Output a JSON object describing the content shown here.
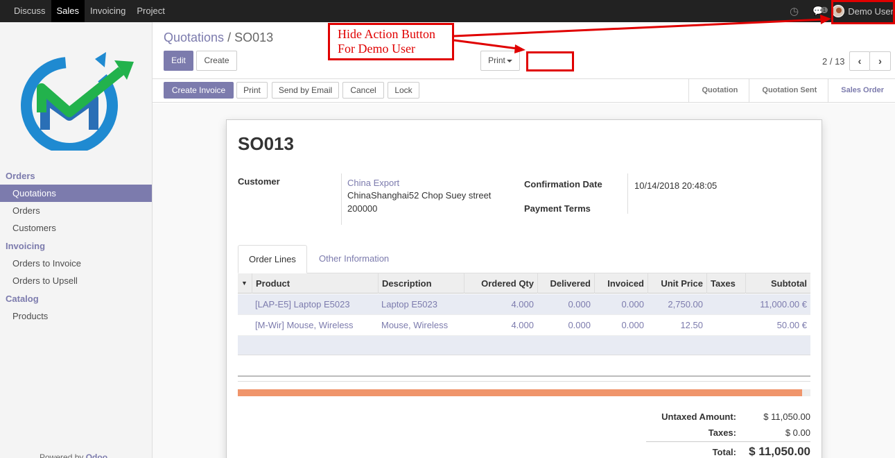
{
  "topbar": {
    "menu": [
      "Discuss",
      "Sales",
      "Invoicing",
      "Project"
    ],
    "active_menu": "Sales",
    "chat_count": "1",
    "user": "Demo User"
  },
  "sidebar": {
    "categories": [
      {
        "label": "Orders",
        "items": [
          "Quotations",
          "Orders",
          "Customers"
        ]
      },
      {
        "label": "Invoicing",
        "items": [
          "Orders to Invoice",
          "Orders to Upsell"
        ]
      },
      {
        "label": "Catalog",
        "items": [
          "Products"
        ]
      }
    ],
    "active_item": "Quotations",
    "powered_prefix": "Powered by",
    "powered_brand": "Odoo"
  },
  "control": {
    "breadcrumb_parent": "Quotations",
    "breadcrumb_sep": "/",
    "breadcrumb_current": "SO013",
    "edit": "Edit",
    "create": "Create",
    "print": "Print",
    "pager": "2 / 13"
  },
  "actions": {
    "create_invoice": "Create Invoice",
    "print": "Print",
    "send_email": "Send by Email",
    "cancel": "Cancel",
    "lock": "Lock"
  },
  "stages": {
    "items": [
      "Quotation",
      "Quotation Sent",
      "Sales Order"
    ],
    "current": "Sales Order"
  },
  "form": {
    "name": "SO013",
    "customer_label": "Customer",
    "customer_name": "China Export",
    "customer_addr1": "ChinaShanghai52 Chop Suey street",
    "customer_addr2": "200000",
    "confirmation_label": "Confirmation Date",
    "confirmation_value": "10/14/2018 20:48:05",
    "payment_terms_label": "Payment Terms"
  },
  "tabs": [
    "Order Lines",
    "Other Information"
  ],
  "table": {
    "headers": [
      "Product",
      "Description",
      "Ordered Qty",
      "Delivered",
      "Invoiced",
      "Unit Price",
      "Taxes",
      "Subtotal"
    ],
    "rows": [
      [
        "[LAP-E5] Laptop E5023",
        "Laptop E5023",
        "4.000",
        "0.000",
        "0.000",
        "2,750.00",
        "",
        "11,000.00 €"
      ],
      [
        "[M-Wir] Mouse, Wireless",
        "Mouse, Wireless",
        "4.000",
        "0.000",
        "0.000",
        "12.50",
        "",
        "50.00 €"
      ]
    ]
  },
  "progress_fraction": 0.986,
  "totals": {
    "untaxed_label": "Untaxed Amount:",
    "untaxed_value": "$ 11,050.00",
    "taxes_label": "Taxes:",
    "taxes_value": "$ 0.00",
    "total_label": "Total:",
    "total_value": "$ 11,050.00"
  },
  "annotation": {
    "line1": "Hide Action Button",
    "line2": "For Demo User",
    "color": "#e00000"
  },
  "colors": {
    "primary": "#7c7bad",
    "navbar": "#222222",
    "progress": "#f0956b"
  }
}
